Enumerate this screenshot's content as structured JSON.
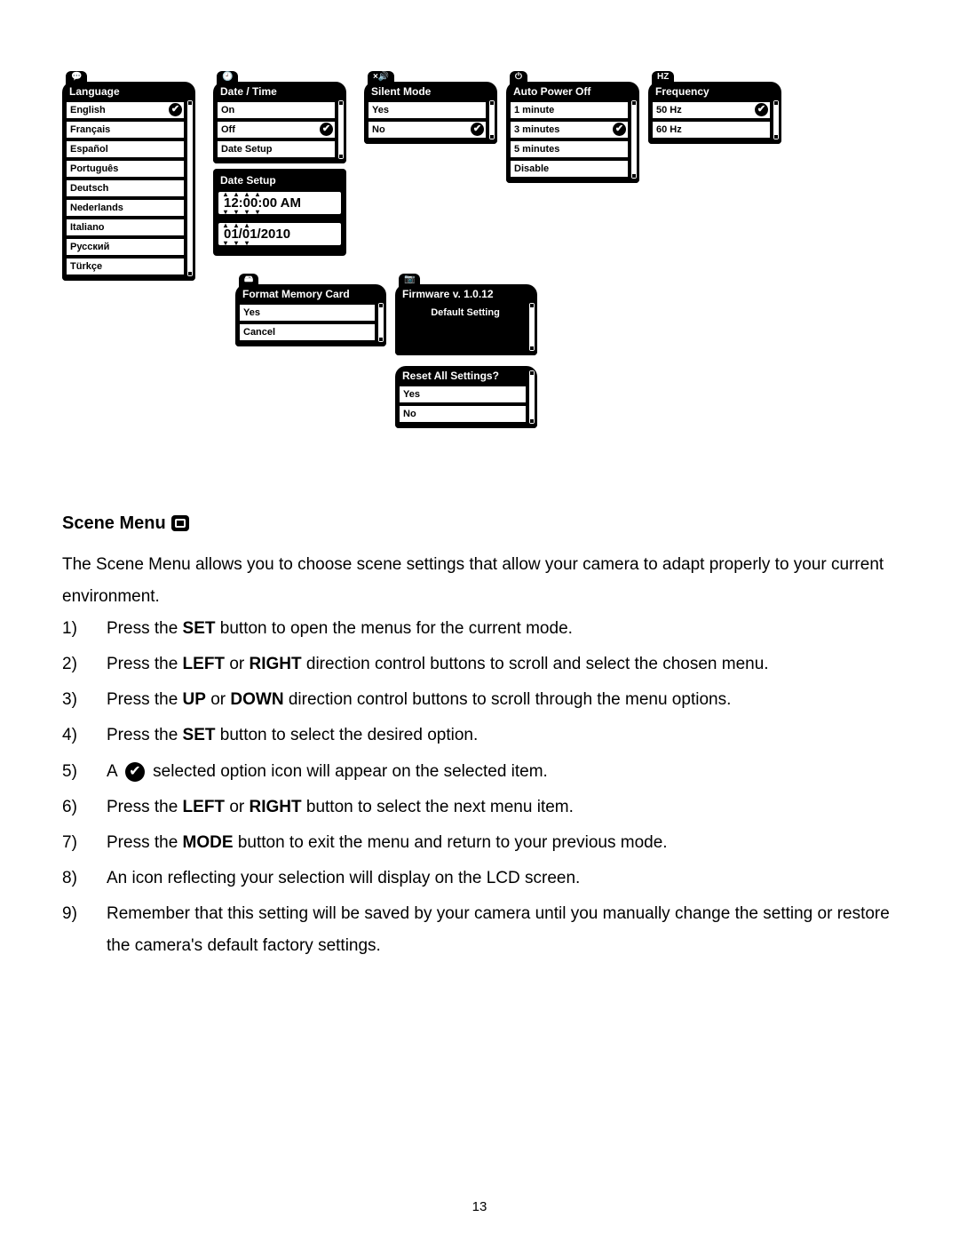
{
  "menus": {
    "language": {
      "tab": "💬",
      "title": "Language",
      "items": [
        "English",
        "Français",
        "Español",
        "Português",
        "Deutsch",
        "Nederlands",
        "Italiano",
        "Русский",
        "Türkçe"
      ],
      "selected_index": 0
    },
    "datetime": {
      "tab": "🕘",
      "title": "Date / Time",
      "items": [
        "On",
        "Off",
        "Date Setup"
      ],
      "selected_index": 1
    },
    "date_setup": {
      "title": "Date Setup",
      "time": "12:00:00 AM",
      "date": "01/01/2010"
    },
    "silent": {
      "tab": "×🔊",
      "title": "Silent Mode",
      "items": [
        "Yes",
        "No"
      ],
      "selected_index": 1
    },
    "autopower": {
      "tab": "⏻",
      "title": "Auto Power Off",
      "items": [
        "1 minute",
        "3 minutes",
        "5 minutes",
        "Disable"
      ],
      "selected_index": 1
    },
    "frequency": {
      "tab": "HZ",
      "title": "Frequency",
      "items": [
        "50 Hz",
        "60 Hz"
      ],
      "selected_index": 0
    },
    "format": {
      "tab": "🖴",
      "title": "Format Memory Card",
      "items": [
        "Yes",
        "Cancel"
      ]
    },
    "firmware": {
      "tab": "📷",
      "title": "Firmware v. 1.0.12",
      "highlight": "Default Setting"
    },
    "reset": {
      "title": "Reset All Settings?",
      "items": [
        "Yes",
        "No"
      ]
    }
  },
  "section": {
    "heading": "Scene Menu",
    "intro": "The Scene Menu allows you to choose scene settings that allow your camera to adapt properly to your current environment.",
    "steps": [
      {
        "n": "1)",
        "pre": "Press the ",
        "b": "SET",
        "post": " button to open the menus for the current mode."
      },
      {
        "n": "2)",
        "pre": "Press the ",
        "b": "LEFT",
        "mid": " or ",
        "b2": "RIGHT",
        "post": " direction control buttons to scroll and select the chosen menu."
      },
      {
        "n": "3)",
        "pre": "Press the ",
        "b": "UP",
        "mid": " or ",
        "b2": "DOWN",
        "post": " direction control buttons to scroll through the menu options."
      },
      {
        "n": "4)",
        "pre": "Press the ",
        "b": "SET",
        "post": " button to select the desired option."
      },
      {
        "n": "5)",
        "pre": "A ",
        "icon": true,
        "post": " selected option icon will appear on the selected item."
      },
      {
        "n": "6)",
        "pre": "Press the ",
        "b": "LEFT",
        "mid": " or ",
        "b2": "RIGHT",
        "post": " button to select the next menu item."
      },
      {
        "n": "7)",
        "pre": "Press the ",
        "b": "MODE",
        "post": " button to exit the menu and return to your previous mode."
      },
      {
        "n": "8)",
        "pre": "An icon reflecting your selection will display on the LCD screen."
      },
      {
        "n": "9)",
        "pre": "Remember that this setting will be saved by your camera until you manually change the setting or restore the camera's default factory settings."
      }
    ]
  },
  "page_number": "13"
}
